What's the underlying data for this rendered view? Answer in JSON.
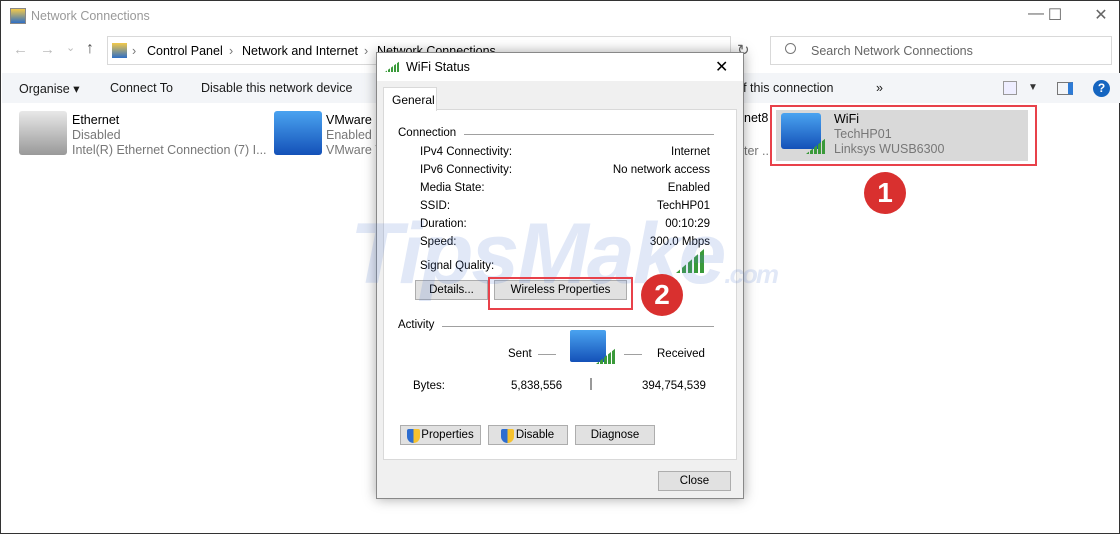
{
  "window": {
    "title": "Network Connections",
    "minimize": "—",
    "maximize": "☐",
    "close": "✕"
  },
  "nav": {
    "back": "←",
    "forward": "→",
    "recent": "⌄",
    "up": "↑",
    "breadcrumb": [
      "Control Panel",
      "Network and Internet",
      "Network Connections"
    ],
    "refresh": "↻"
  },
  "search": {
    "placeholder": "Search Network Connections"
  },
  "toolbar": {
    "organise": "Organise ▾",
    "connect_to": "Connect To",
    "disable": "Disable this network device",
    "status": "View status of this connection",
    "more": "»"
  },
  "connections": [
    {
      "name": "Ethernet",
      "status": "Disabled",
      "device": "Intel(R) Ethernet Connection (7) I..."
    },
    {
      "name": "VMware Network Adapter VMnet8",
      "status": "Enabled",
      "device": "VMware Virtual Ethernet Adapter ..."
    },
    {
      "name": "WiFi",
      "status": "TechHP01",
      "device": "Linksys WUSB6300"
    }
  ],
  "dialog": {
    "title": "WiFi Status",
    "close": "✕",
    "tab": "General",
    "connection_label": "Connection",
    "rows": [
      {
        "label": "IPv4 Connectivity:",
        "value": "Internet"
      },
      {
        "label": "IPv6 Connectivity:",
        "value": "No network access"
      },
      {
        "label": "Media State:",
        "value": "Enabled"
      },
      {
        "label": "SSID:",
        "value": "TechHP01"
      },
      {
        "label": "Duration:",
        "value": "00:10:29"
      },
      {
        "label": "Speed:",
        "value": "300.0 Mbps"
      }
    ],
    "signal_label": "Signal Quality:",
    "signal_level": "5/5",
    "details_btn": "Details...",
    "wireless_btn": "Wireless Properties",
    "activity_label": "Activity",
    "sent": "Sent",
    "received": "Received",
    "bytes_label": "Bytes:",
    "bytes_sent": "5,838,556",
    "bytes_received": "394,754,539",
    "properties_btn": "Properties",
    "disable_btn": "Disable",
    "diagnose_btn": "Diagnose",
    "close_btn": "Close"
  },
  "annotations": {
    "step1": "1",
    "step2": "2"
  },
  "watermark": "TipsMake.com",
  "colors": {
    "highlight": "#e8414a",
    "badge": "#d9302f",
    "signal": "#3a9a3a"
  }
}
